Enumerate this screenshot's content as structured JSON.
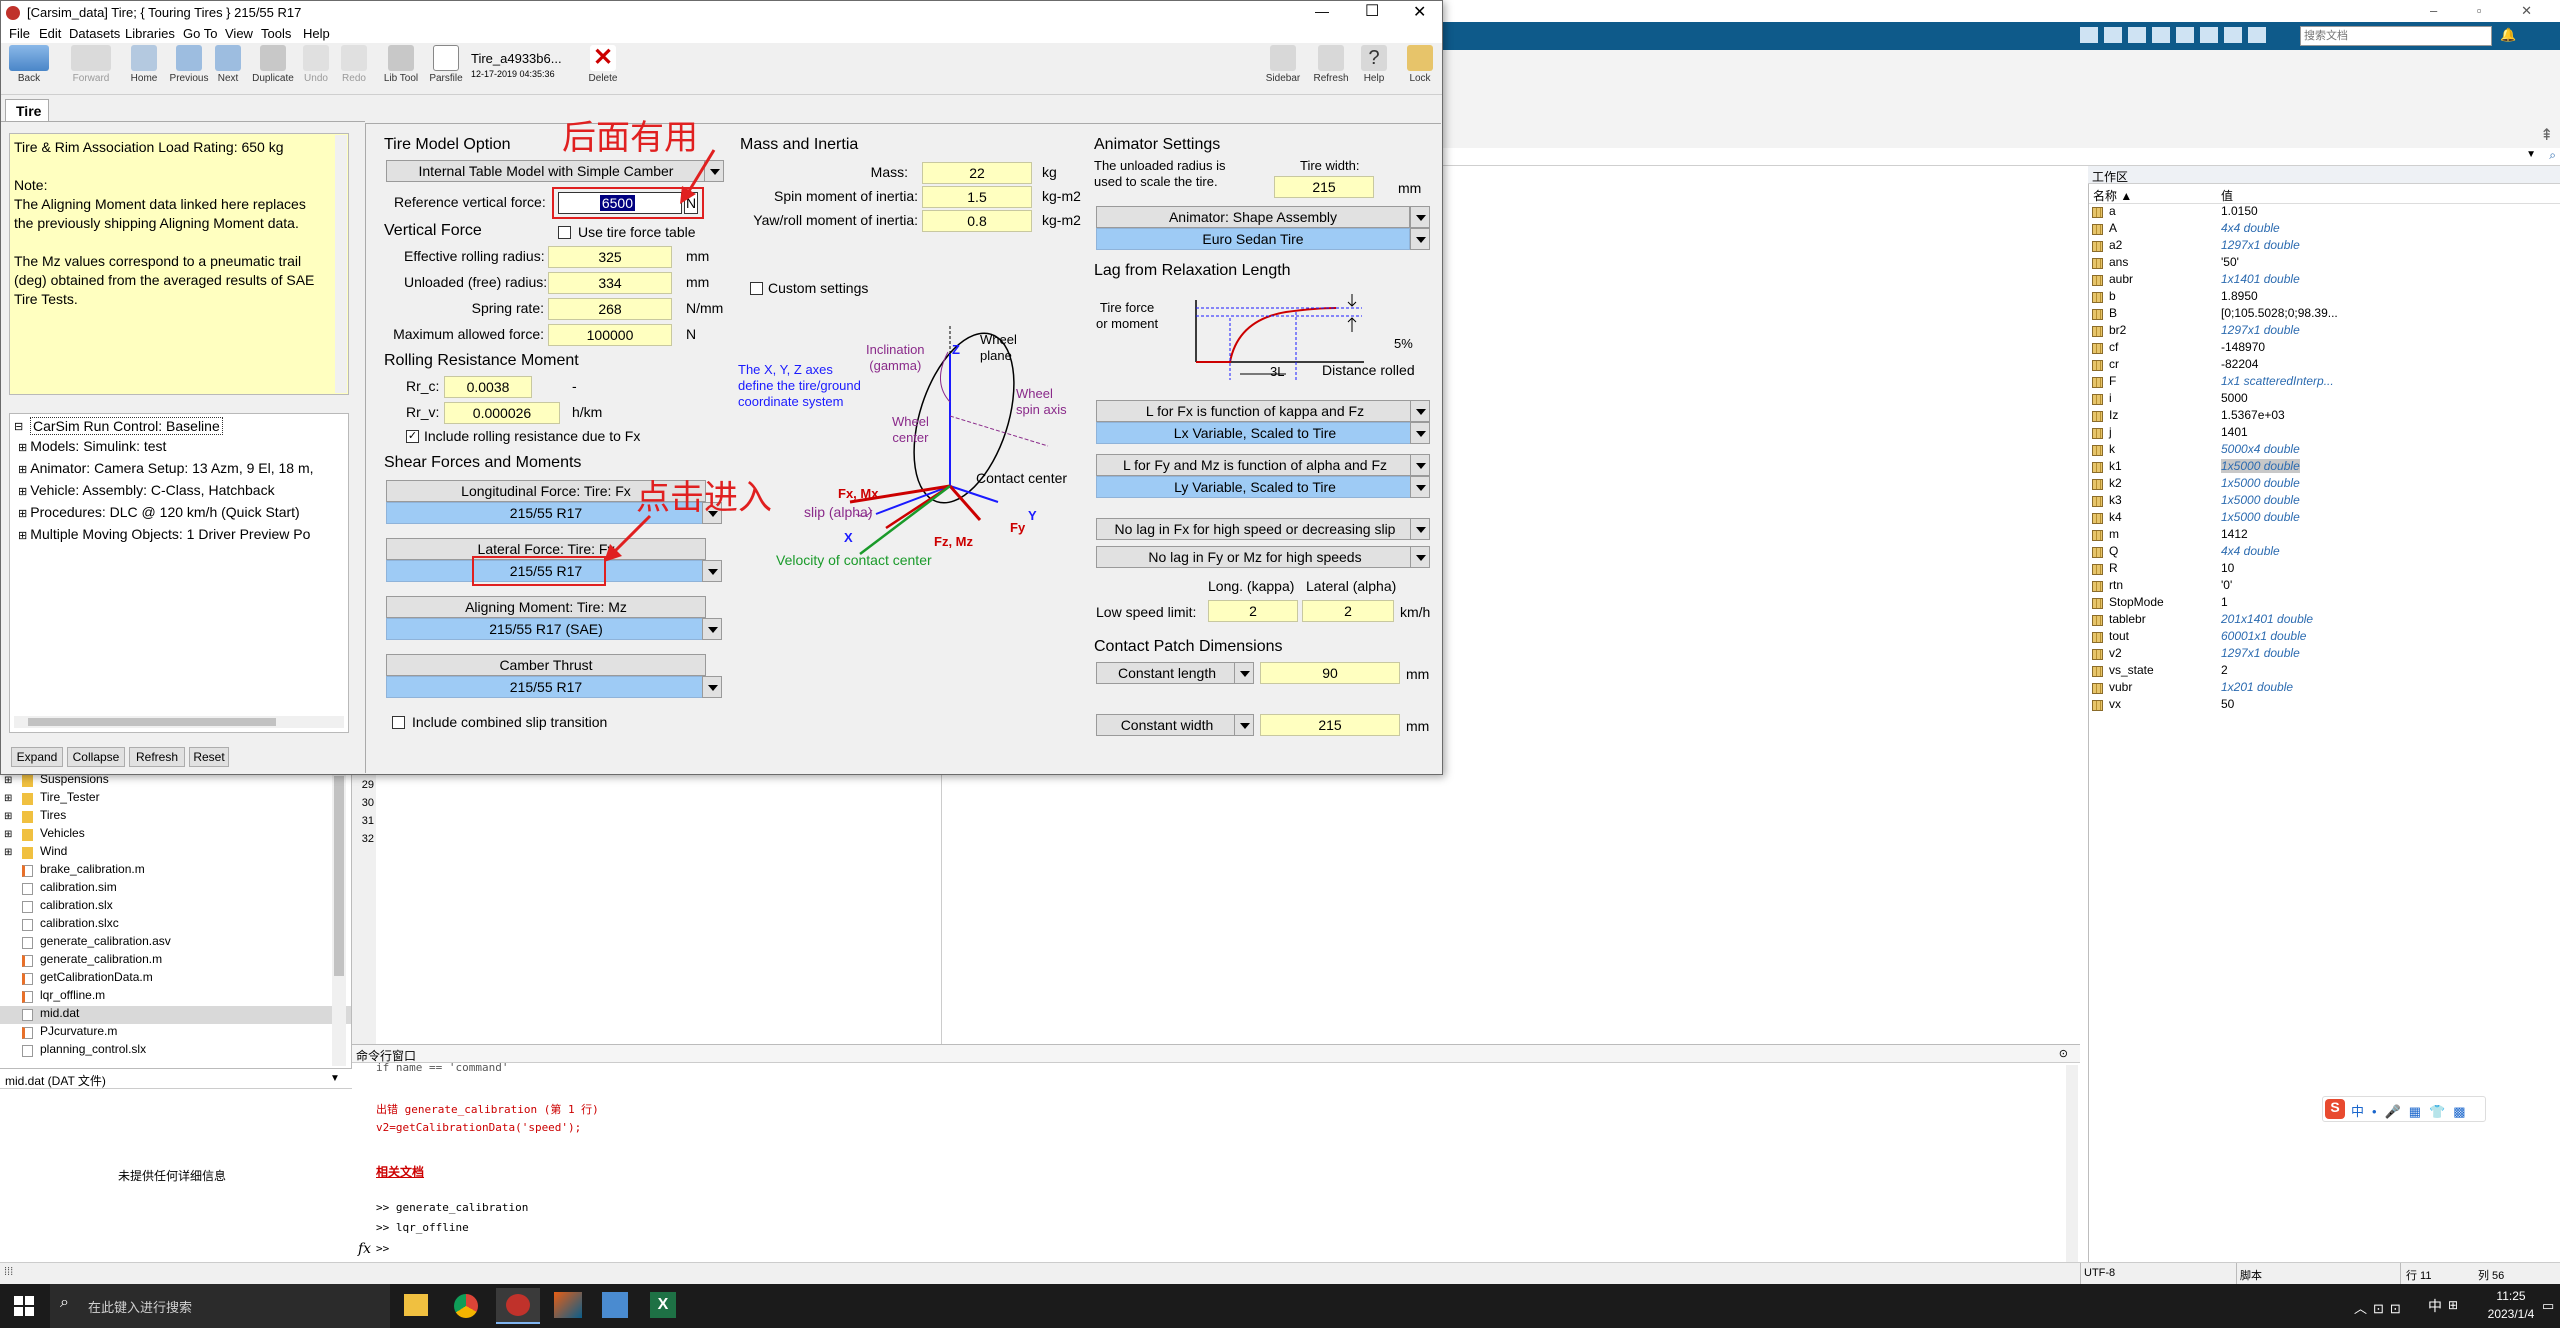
{
  "window": {
    "title": "[Carsim_data] Tire; { Touring Tires } 215/55 R17",
    "menu": [
      "File",
      "Edit",
      "Datasets",
      "Libraries",
      "Go To",
      "View",
      "Tools",
      "Help"
    ],
    "toolbar": {
      "back": "Back",
      "forward": "Forward",
      "home": "Home",
      "previous": "Previous",
      "next": "Next",
      "duplicate": "Duplicate",
      "undo": "Undo",
      "redo": "Redo",
      "libtool": "Lib Tool",
      "parsfile": "Parsfile",
      "dataset_name": "Tire_a4933b6...",
      "dataset_date": "12-17-2019 04:35:36",
      "delete": "Delete",
      "sidebar": "Sidebar",
      "refresh": "Refresh",
      "help": "Help",
      "lock": "Lock"
    },
    "tab": "Tire"
  },
  "notes": {
    "lines": [
      "Tire & Rim Association Load Rating: 650 kg",
      "",
      "Note:",
      "The Aligning Moment data linked here replaces",
      "the previously shipping Aligning Moment data.",
      "",
      "The Mz values correspond to a pneumatic trail",
      "(deg) obtained from the averaged results of SAE",
      "Tire Tests."
    ]
  },
  "tree": {
    "root": "CarSim Run Control: Baseline",
    "items": [
      "Models: Simulink: test",
      "Animator: Camera Setup: 13 Azm, 9 El, 18 m,",
      "Vehicle: Assembly: C-Class, Hatchback",
      "Procedures: DLC @ 120 km/h (Quick Start)",
      "Multiple Moving Objects: 1 Driver Preview Po"
    ],
    "buttons": [
      "Expand",
      "Collapse",
      "Refresh",
      "Reset"
    ]
  },
  "tire_model": {
    "header": "Tire Model Option",
    "option": "Internal Table Model with Simple Camber",
    "ref_force_label": "Reference vertical force:",
    "ref_force": "6500",
    "ref_force_unit": "N"
  },
  "vertical_force": {
    "header": "Vertical Force",
    "use_table": "Use tire force table",
    "rows": [
      {
        "label": "Effective rolling radius:",
        "value": "325",
        "unit": "mm"
      },
      {
        "label": "Unloaded (free) radius:",
        "value": "334",
        "unit": "mm"
      },
      {
        "label": "Spring rate:",
        "value": "268",
        "unit": "N/mm"
      },
      {
        "label": "Maximum allowed force:",
        "value": "100000",
        "unit": "N"
      }
    ]
  },
  "rolling_resistance": {
    "header": "Rolling Resistance Moment",
    "rr_c_label": "Rr_c:",
    "rr_c": "0.0038",
    "rr_c_unit": "-",
    "rr_v_label": "Rr_v:",
    "rr_v": "0.000026",
    "rr_v_unit": "h/km",
    "include": "Include rolling resistance due to Fx"
  },
  "shear": {
    "header": "Shear Forces and Moments",
    "items": [
      {
        "title": "Longitudinal Force: Tire: Fx",
        "value": "215/55 R17"
      },
      {
        "title": "Lateral Force: Tire: Fy",
        "value": "215/55 R17"
      },
      {
        "title": "Aligning Moment: Tire: Mz",
        "value": "215/55 R17 (SAE)"
      },
      {
        "title": "Camber Thrust",
        "value": "215/55 R17"
      }
    ],
    "combined": "Include combined slip transition"
  },
  "mass": {
    "header": "Mass and Inertia",
    "rows": [
      {
        "label": "Mass:",
        "value": "22",
        "unit": "kg"
      },
      {
        "label": "Spin moment of inertia:",
        "value": "1.5",
        "unit": "kg-m2"
      },
      {
        "label": "Yaw/roll moment of inertia:",
        "value": "0.8",
        "unit": "kg-m2"
      }
    ],
    "custom": "Custom settings"
  },
  "diagram": {
    "axes_text": [
      "The X, Y, Z axes",
      "define the tire/ground",
      "coordinate system"
    ],
    "inclination": [
      "Inclination",
      "(gamma)"
    ],
    "wheel_plane": [
      "Wheel",
      "plane"
    ],
    "wheel_spin": [
      "Wheel",
      "spin axis"
    ],
    "wheel_center": [
      "Wheel",
      "center"
    ],
    "contact_center": "Contact center",
    "fx_mx": "Fx, Mx",
    "slip": "slip (alpha)",
    "fz_mz": "Fz, Mz",
    "fy": "Fy",
    "x": "X",
    "y": "Y",
    "z": "Z",
    "velocity": "Velocity of contact center"
  },
  "animator": {
    "header": "Animator Settings",
    "desc": [
      "The unloaded radius is",
      "used to scale the tire."
    ],
    "width_label": "Tire width:",
    "width": "215",
    "width_unit": "mm",
    "shape_title": "Animator: Shape Assembly",
    "shape_value": "Euro Sedan Tire"
  },
  "lag": {
    "header": "Lag from Relaxation Length",
    "tire_force": [
      "Tire force",
      "or moment"
    ],
    "pct": "5%",
    "three_l": "3L",
    "distance": "Distance rolled",
    "fx_title": "L for Fx is function of kappa and Fz",
    "fx_value": "Lx Variable, Scaled to Tire",
    "fy_title": "L for Fy and Mz is function of alpha and Fz",
    "fy_value": "Ly Variable, Scaled to Tire",
    "nolag_fx": "No lag in Fx for high speed or decreasing slip",
    "nolag_fy": "No lag in Fy or Mz for high speeds",
    "long_label": "Long. (kappa)",
    "lat_label": "Lateral (alpha)",
    "low_speed_label": "Low speed limit:",
    "low_long": "2",
    "low_lat": "2",
    "low_unit": "km/h"
  },
  "contact": {
    "header": "Contact Patch Dimensions",
    "length_mode": "Constant length",
    "length": "90",
    "length_unit": "mm",
    "width_mode": "Constant width",
    "width": "215",
    "width_unit": "mm"
  },
  "annotations": {
    "top": "后面有用",
    "mid": "点击进入"
  },
  "matlab": {
    "search_placeholder": "搜索文档",
    "ws_title": "工作区",
    "ws_cols": [
      "名称 ▲",
      "值"
    ],
    "ws": [
      {
        "n": "a",
        "v": "1.0150",
        "i": false
      },
      {
        "n": "A",
        "v": "4x4 double",
        "i": true
      },
      {
        "n": "a2",
        "v": "1297x1 double",
        "i": true
      },
      {
        "n": "ans",
        "v": "'50'",
        "i": false
      },
      {
        "n": "aubr",
        "v": "1x1401 double",
        "i": true
      },
      {
        "n": "b",
        "v": "1.8950",
        "i": false
      },
      {
        "n": "B",
        "v": "[0;105.5028;0;98.39...",
        "i": false
      },
      {
        "n": "br2",
        "v": "1297x1 double",
        "i": true
      },
      {
        "n": "cf",
        "v": "-148970",
        "i": false
      },
      {
        "n": "cr",
        "v": "-82204",
        "i": false
      },
      {
        "n": "F",
        "v": "1x1 scatteredInterp...",
        "i": true
      },
      {
        "n": "i",
        "v": "5000",
        "i": false
      },
      {
        "n": "Iz",
        "v": "1.5367e+03",
        "i": false
      },
      {
        "n": "j",
        "v": "1401",
        "i": false
      },
      {
        "n": "k",
        "v": "5000x4 double",
        "i": true
      },
      {
        "n": "k1",
        "v": "1x5000 double",
        "i": true
      },
      {
        "n": "k2",
        "v": "1x5000 double",
        "i": true
      },
      {
        "n": "k3",
        "v": "1x5000 double",
        "i": true
      },
      {
        "n": "k4",
        "v": "1x5000 double",
        "i": true
      },
      {
        "n": "m",
        "v": "1412",
        "i": false
      },
      {
        "n": "Q",
        "v": "4x4 double",
        "i": true
      },
      {
        "n": "R",
        "v": "10",
        "i": false
      },
      {
        "n": "rtn",
        "v": "'0'",
        "i": false
      },
      {
        "n": "StopMode",
        "v": "1",
        "i": false
      },
      {
        "n": "tablebr",
        "v": "201x1401 double",
        "i": true
      },
      {
        "n": "tout",
        "v": "60001x1 double",
        "i": true
      },
      {
        "n": "v2",
        "v": "1297x1 double",
        "i": true
      },
      {
        "n": "vs_state",
        "v": "2",
        "i": false
      },
      {
        "n": "vubr",
        "v": "1x201 double",
        "i": true
      },
      {
        "n": "vx",
        "v": "50",
        "i": false
      }
    ],
    "files": [
      {
        "t": "Suspensions",
        "k": "folder"
      },
      {
        "t": "Tire_Tester",
        "k": "folder"
      },
      {
        "t": "Tires",
        "k": "folder"
      },
      {
        "t": "Vehicles",
        "k": "folder"
      },
      {
        "t": "Wind",
        "k": "folder"
      },
      {
        "t": "brake_calibration.m",
        "k": "m"
      },
      {
        "t": "calibration.sim",
        "k": "f"
      },
      {
        "t": "calibration.slx",
        "k": "f"
      },
      {
        "t": "calibration.slxc",
        "k": "f"
      },
      {
        "t": "generate_calibration.asv",
        "k": "f"
      },
      {
        "t": "generate_calibration.m",
        "k": "m"
      },
      {
        "t": "getCalibrationData.m",
        "k": "m"
      },
      {
        "t": "lqr_offline.m",
        "k": "m"
      },
      {
        "t": "mid.dat",
        "k": "f"
      },
      {
        "t": "PJcurvature.m",
        "k": "m"
      },
      {
        "t": "planning_control.slx",
        "k": "f"
      }
    ],
    "file_detail_name": "mid.dat  (DAT 文件)",
    "file_detail_empty": "未提供任何详细信息",
    "line_numbers": [
      "29",
      "30",
      "31",
      "32"
    ],
    "cmd_title": "命令行窗口",
    "cmd_lines": [
      {
        "t": "if name == 'command'",
        "c": "#555"
      },
      {
        "t": "出错 generate_calibration (第 1 行)",
        "c": "#c00"
      },
      {
        "t": "v2=getCalibrationData('speed');",
        "c": "#c00"
      },
      {
        "t": "相关文档",
        "c": "#c00"
      },
      {
        "t": ">> generate_calibration",
        "c": "#000"
      },
      {
        "t": ">> lqr_offline",
        "c": "#000"
      },
      {
        "t": ">>",
        "c": "#000"
      }
    ],
    "status_enc": "UTF-8",
    "status_script": "脚本",
    "status_row": "行  11",
    "status_col": "列  56"
  },
  "taskbar": {
    "search": "在此键入进行搜索",
    "time": "11:25",
    "date": "2023/1/4",
    "ime": "中"
  }
}
